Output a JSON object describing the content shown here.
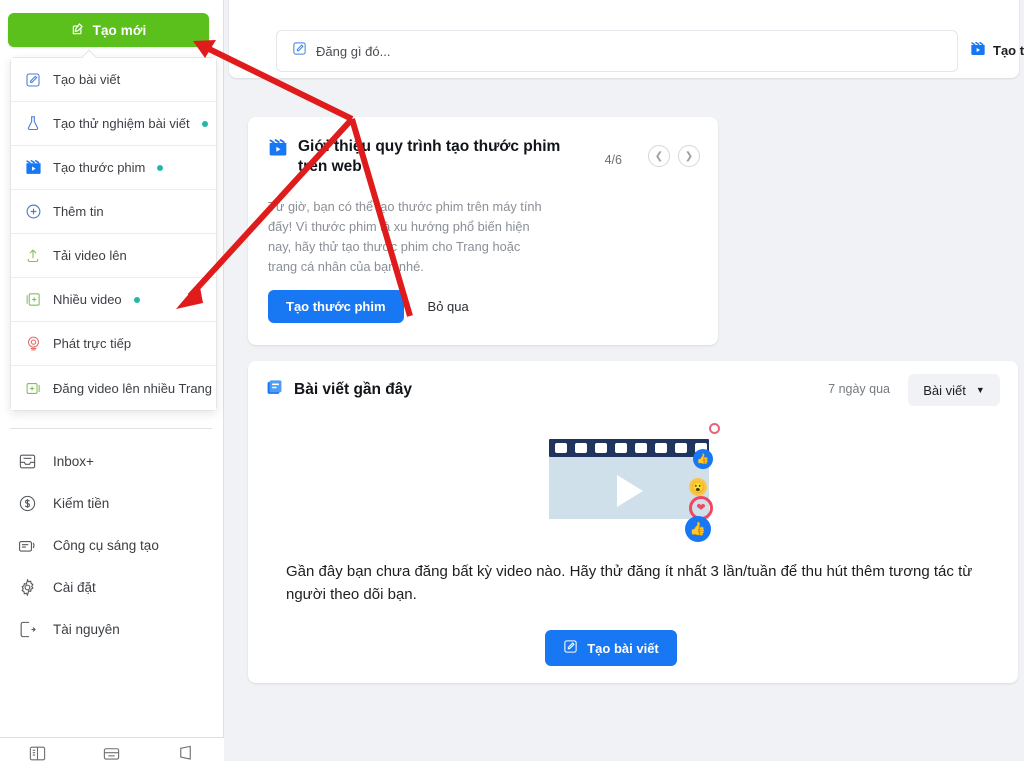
{
  "sidebar": {
    "create_button": {
      "label": "Tạo mới",
      "icon": "compose-icon",
      "color": "#5bc01c"
    },
    "create_menu": [
      {
        "label": "Tạo bài viết",
        "icon": "compose-icon",
        "badge": false
      },
      {
        "label": "Tạo thử nghiệm bài viết",
        "icon": "flask-icon",
        "badge": true
      },
      {
        "label": "Tạo thước phim",
        "icon": "reels-icon",
        "badge": true
      },
      {
        "label": "Thêm tin",
        "icon": "plus-circle-icon",
        "badge": false
      },
      {
        "label": "Tải video lên",
        "icon": "upload-icon",
        "badge": false
      },
      {
        "label": "Nhiều video",
        "icon": "multi-video-icon",
        "badge": true
      },
      {
        "label": "Phát trực tiếp",
        "icon": "live-icon",
        "badge": false
      },
      {
        "label": "Đăng video lên nhiều Trang",
        "icon": "cross-post-icon",
        "badge": false
      }
    ],
    "nav_items": [
      {
        "label": "Inbox+",
        "icon": "inbox-icon"
      },
      {
        "label": "Kiếm tiền",
        "icon": "dollar-circle-icon"
      },
      {
        "label": "Công cụ sáng tạo",
        "icon": "creative-tools-icon"
      },
      {
        "label": "Cài đặt",
        "icon": "gear-icon"
      },
      {
        "label": "Tài nguyên",
        "icon": "resources-icon"
      }
    ],
    "bottom_bar": [
      {
        "icon": "pages-icon"
      },
      {
        "icon": "news-feed-icon"
      },
      {
        "icon": "notification-icon"
      }
    ]
  },
  "composer": {
    "placeholder": "Đăng gì đó...",
    "icon": "compose-icon",
    "reels_button": {
      "label": "Tạo t",
      "icon": "reels-icon"
    }
  },
  "promo": {
    "icon": "reels-icon",
    "title": "Giới thiệu quy trình tạo thước phim trên web",
    "counter": "4/6",
    "prev_icon": "chevron-left-icon",
    "next_icon": "chevron-right-icon",
    "body": "Từ giờ, bạn có thể tạo thước phim trên máy tính đấy! Vì thước phim là xu hướng phổ biến hiện nay, hãy thử tạo thước phim cho Trang hoặc trang cá nhân của bạn nhé.",
    "cta_label": "Tạo thước phim",
    "skip_label": "Bỏ qua",
    "accent": "#1877f2"
  },
  "recent": {
    "icon": "posts-icon",
    "title": "Bài viết gần đây",
    "range": "7 ngày qua",
    "filter_label": "Bài viết",
    "filter_arrow": "chevron-down-icon",
    "empty_text": "Gần đây bạn chưa đăng bất kỳ video nào. Hãy thử đăng ít nhất 3 lần/tuần để thu hút thêm tương tác từ người theo dõi bạn.",
    "cta": {
      "label": "Tạo bài viết",
      "icon": "compose-icon"
    },
    "illustration": {
      "name": "video-reactions-illustration",
      "reactions": [
        "heart-outline",
        "like",
        "wow",
        "love",
        "like-large"
      ]
    }
  },
  "annotations": {
    "arrow_color": "#e01b1b",
    "arrows": [
      {
        "name": "arrow-to-create-button"
      },
      {
        "name": "arrow-to-multi-video-item"
      }
    ]
  }
}
